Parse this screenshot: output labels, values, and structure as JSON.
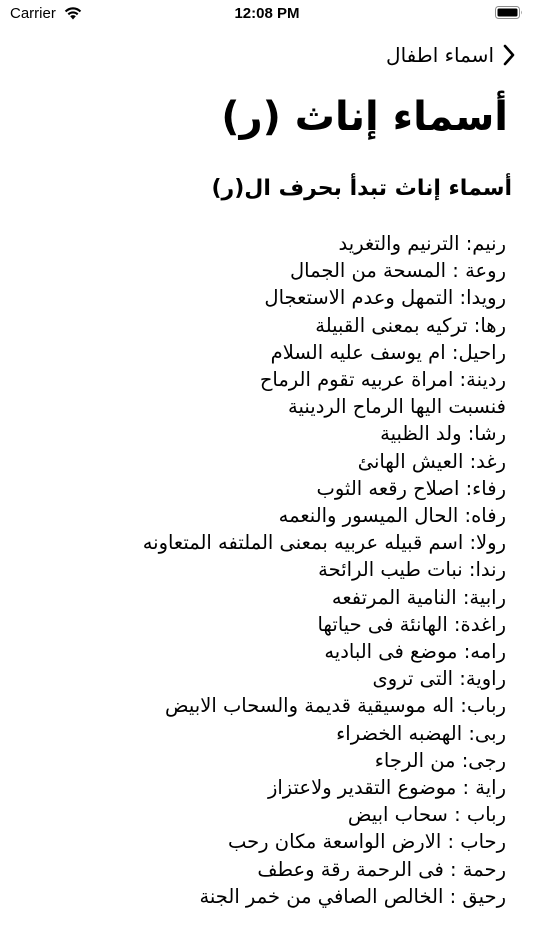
{
  "status_bar": {
    "carrier": "Carrier",
    "time": "12:08 PM"
  },
  "nav": {
    "back_label": "اسماء اطفال"
  },
  "page": {
    "title": "أسماء إناث (ر)",
    "section_heading": "أسماء إناث تبدأ بحرف ال(ر)",
    "lines": [
      "رنيم: الترنيم والتغريد",
      "روعة : المسحة من الجمال",
      "رويدا: التمهل وعدم الاستعجال",
      "رها: تركيه بمعنى القبيلة",
      "راحيل: ام يوسف عليه السلام",
      "ردينة: امراة عربيه تقوم الرماح",
      "فنسبت اليها الرماح الردينية",
      "رشا: ولد الظبية",
      "رغد: العيش الهانئ",
      "رفاء: اصلاح رقعه الثوب",
      "رفاه: الحال الميسور والنعمه",
      "رولا: اسم قبيله عربيه بمعنى الملتفه المتعاونه",
      "رندا: نبات طيب الرائحة",
      "رابية: النامية المرتفعه",
      "راغدة: الهانئة فى حياتها",
      "رامه: موضع فى الباديه",
      "راوية: التى تروى",
      "رباب: اله موسيقية قديمة والسحاب الابيض",
      "ربى: الهضبه الخضراء",
      "رجى: من الرجاء",
      "راية : موضوع التقدير ولاعتزاز",
      "رباب : سحاب ابيض",
      "رحاب : الارض الواسعة مكان رحب",
      "رحمة : فى الرحمة رقة وعطف",
      "رحيق : الخالص الصافي من خمر الجنة"
    ]
  }
}
